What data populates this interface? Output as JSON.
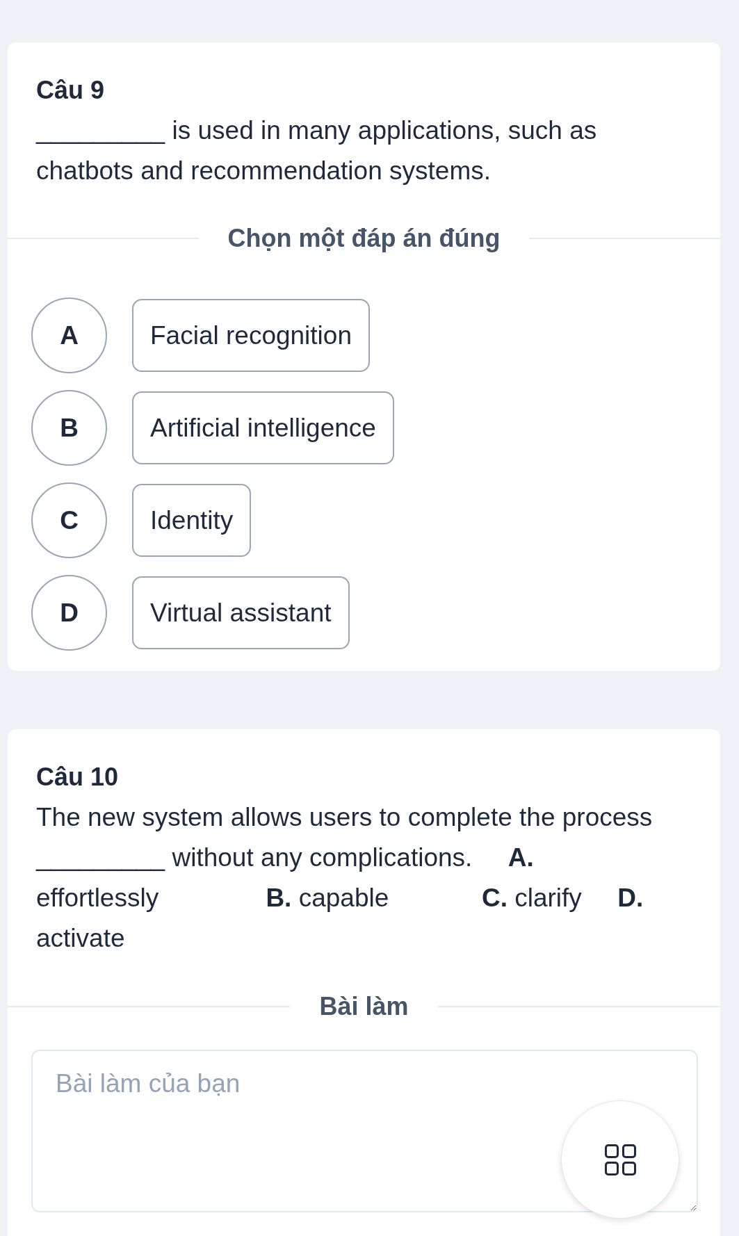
{
  "questions": [
    {
      "kind": "choice",
      "title": "Câu 9",
      "text": "_________ is used in many applications, such as chatbots and recommendation systems.",
      "divider": "Chọn một đáp án đúng",
      "options": [
        {
          "letter": "A",
          "text": "Facial recognition",
          "selected": false
        },
        {
          "letter": "B",
          "text": "Artificial intelligence",
          "selected": false
        },
        {
          "letter": "C",
          "text": "Identity",
          "selected": false
        },
        {
          "letter": "D",
          "text": "Virtual assistant",
          "selected": false
        }
      ]
    },
    {
      "kind": "essay",
      "title": "Câu 10",
      "text": "The new system allows users to complete the process _________ without any complications.     **A.** effortlessly               **B.** capable             **C.** clarify     **D.** activate",
      "divider": "Bài làm",
      "answer": {
        "placeholder": "Bài làm của bạn"
      }
    }
  ]
}
